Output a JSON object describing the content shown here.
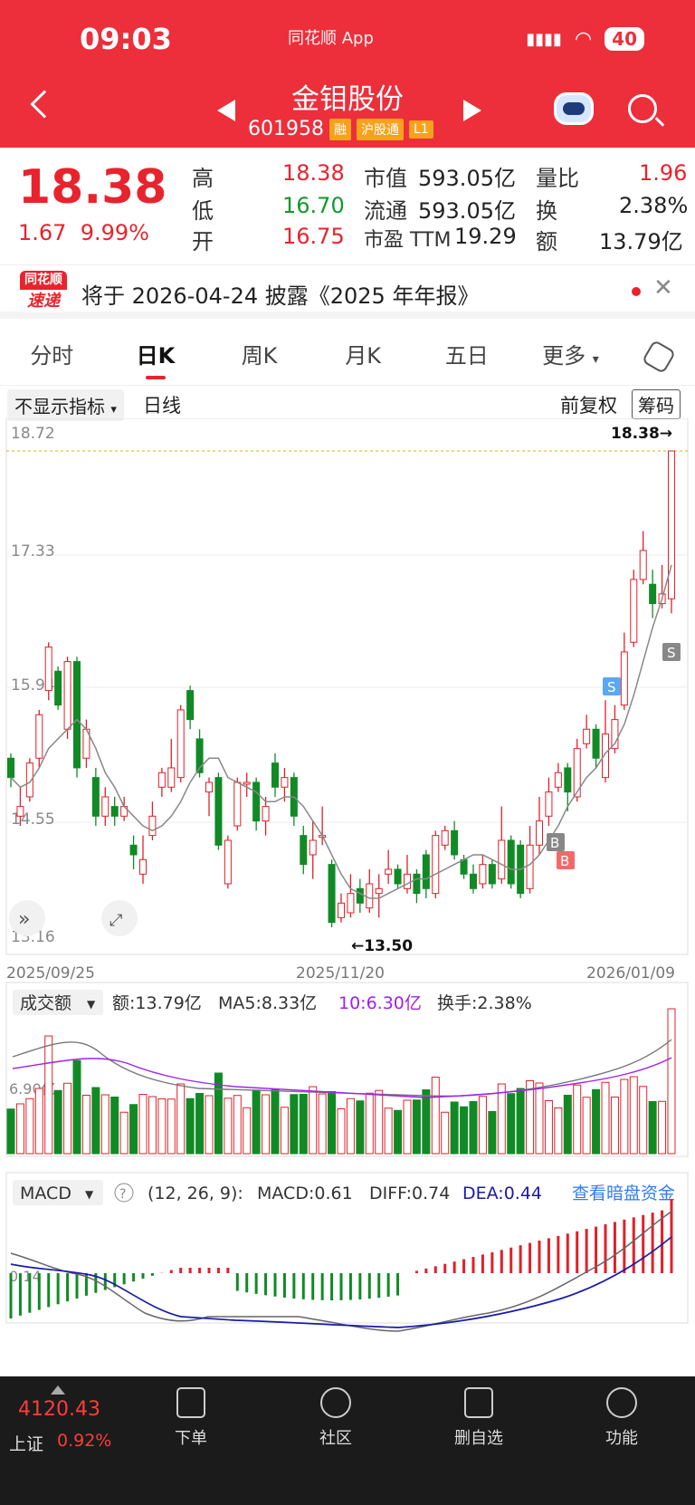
{
  "status_bar": {
    "time": "09:03",
    "app_label": "同花顺 App",
    "battery": "40"
  },
  "header": {
    "name": "金钼股份",
    "code": "601958",
    "tags": [
      "融",
      "沪股通",
      "L1"
    ]
  },
  "quote": {
    "price": "18.38",
    "change": "1.67",
    "change_pct": "9.99%",
    "rows": [
      {
        "l1": "高",
        "v1": "18.38",
        "c1": "red",
        "l2": "市值",
        "v2": "593.05亿",
        "l3": "量比",
        "v3": "1.96",
        "c3": "red"
      },
      {
        "l1": "低",
        "v1": "16.70",
        "c1": "green",
        "l2": "流通",
        "v2": "593.05亿",
        "l3": "换",
        "v3": "2.38%",
        "c3": "black"
      },
      {
        "l1": "开",
        "v1": "16.75",
        "c1": "red",
        "l2": "市盈 TTM",
        "v2": "19.29",
        "l3": "额",
        "v3": "13.79亿",
        "c3": "black"
      }
    ]
  },
  "notice": {
    "logo_top": "同花顺",
    "logo_bottom": "速递",
    "text": "将于 2026-04-24 披露《2025 年年报》"
  },
  "tabs": [
    "分时",
    "日K",
    "周K",
    "月K",
    "五日",
    "更多"
  ],
  "chart_toolbar": {
    "indicator": "不显示指标",
    "line": "日线",
    "adjust": "前复权",
    "chips": "筹码"
  },
  "price_axis": [
    "18.72",
    "17.33",
    "15.94",
    "14.55",
    "13.16"
  ],
  "date_axis": [
    "2025/09/25",
    "2025/11/20",
    "2026/01/09"
  ],
  "markers": {
    "high": "18.38→",
    "low": "←13.50",
    "sell": "S",
    "buy": "B"
  },
  "volume": {
    "label": "成交额",
    "amount": "额:13.79亿",
    "ma5": "MA5:8.33亿",
    "ma10": "10:6.30亿",
    "turnover": "换手:2.38%",
    "axis": "6.90亿"
  },
  "macd": {
    "label": "MACD",
    "params": "(12, 26, 9):",
    "macd": "MACD:0.61",
    "diff": "DIFF:0.74",
    "dea": "DEA:0.44",
    "link": "查看暗盘资金",
    "axis": "0.14"
  },
  "bottom_nav": {
    "index_value": "4120.43",
    "index_name": "上证",
    "index_pct": "0.92%",
    "items": [
      "下单",
      "社区",
      "删自选",
      "功能"
    ]
  },
  "chart_data": {
    "type": "candlestick",
    "candles": [
      [
        15.2,
        15.0,
        15.25,
        14.9
      ],
      [
        14.6,
        14.7,
        14.9,
        14.5
      ],
      [
        14.8,
        15.15,
        15.2,
        14.75
      ],
      [
        15.2,
        15.65,
        15.7,
        15.1
      ],
      [
        15.9,
        16.35,
        16.4,
        15.8
      ],
      [
        16.1,
        15.75,
        16.15,
        15.7
      ],
      [
        15.5,
        16.2,
        16.25,
        15.4
      ],
      [
        16.2,
        15.1,
        16.25,
        15.0
      ],
      [
        15.2,
        15.5,
        15.6,
        15.1
      ],
      [
        15.0,
        14.6,
        15.1,
        14.5
      ],
      [
        14.6,
        14.8,
        14.9,
        14.5
      ],
      [
        14.7,
        14.6,
        14.8,
        14.5
      ],
      [
        14.6,
        14.7,
        14.8,
        14.55
      ],
      [
        14.3,
        14.2,
        14.4,
        14.05
      ],
      [
        14.0,
        14.15,
        14.4,
        13.9
      ],
      [
        14.4,
        14.6,
        14.75,
        14.35
      ],
      [
        14.9,
        15.05,
        15.1,
        14.8
      ],
      [
        14.9,
        15.1,
        15.4,
        14.85
      ],
      [
        15.0,
        15.7,
        15.75,
        14.95
      ],
      [
        15.9,
        15.6,
        15.95,
        15.5
      ],
      [
        15.4,
        15.05,
        15.5,
        15.0
      ],
      [
        14.85,
        14.95,
        15.0,
        14.6
      ],
      [
        15.0,
        14.3,
        15.05,
        14.25
      ],
      [
        13.9,
        14.35,
        14.4,
        13.85
      ],
      [
        14.5,
        14.95,
        15.0,
        14.45
      ],
      [
        14.95,
        14.95,
        15.05,
        14.8
      ],
      [
        14.95,
        14.55,
        15.0,
        14.45
      ],
      [
        14.55,
        14.7,
        14.8,
        14.4
      ],
      [
        15.15,
        14.9,
        15.25,
        14.8
      ],
      [
        14.9,
        15.0,
        15.1,
        14.75
      ],
      [
        15.0,
        14.6,
        15.05,
        14.5
      ],
      [
        14.4,
        14.1,
        14.5,
        14.0
      ],
      [
        14.2,
        14.35,
        14.55,
        13.95
      ],
      [
        14.4,
        14.4,
        14.7,
        14.3
      ],
      [
        14.1,
        13.5,
        14.15,
        13.45
      ],
      [
        13.55,
        13.7,
        13.8,
        13.5
      ],
      [
        13.6,
        13.8,
        14.0,
        13.55
      ],
      [
        13.85,
        13.7,
        13.95,
        13.6
      ],
      [
        13.65,
        13.9,
        14.05,
        13.6
      ],
      [
        13.8,
        13.85,
        14.0,
        13.55
      ],
      [
        14.0,
        14.05,
        14.25,
        13.9
      ],
      [
        14.05,
        13.9,
        14.1,
        13.85
      ],
      [
        13.85,
        14.0,
        14.2,
        13.8
      ],
      [
        14.0,
        13.8,
        14.05,
        13.7
      ],
      [
        14.2,
        13.85,
        14.25,
        13.75
      ],
      [
        13.8,
        14.4,
        14.45,
        13.75
      ],
      [
        14.3,
        14.45,
        14.5,
        14.25
      ],
      [
        14.45,
        14.2,
        14.55,
        14.15
      ],
      [
        14.15,
        14.0,
        14.2,
        13.95
      ],
      [
        14.0,
        13.85,
        14.1,
        13.8
      ],
      [
        13.9,
        14.1,
        14.2,
        13.85
      ],
      [
        14.1,
        13.9,
        14.15,
        13.85
      ],
      [
        13.95,
        14.35,
        14.7,
        13.9
      ],
      [
        14.35,
        13.9,
        14.4,
        13.85
      ],
      [
        14.3,
        13.8,
        14.35,
        13.75
      ],
      [
        13.85,
        14.3,
        14.5,
        13.8
      ],
      [
        14.3,
        14.55,
        14.8,
        14.2
      ],
      [
        14.6,
        14.85,
        15.0,
        14.5
      ],
      [
        14.9,
        15.05,
        15.15,
        14.85
      ],
      [
        15.1,
        14.85,
        15.15,
        14.65
      ],
      [
        14.8,
        15.3,
        15.4,
        14.75
      ],
      [
        15.35,
        15.5,
        15.65,
        15.3
      ],
      [
        15.5,
        15.2,
        15.55,
        15.1
      ],
      [
        15.0,
        15.45,
        15.8,
        14.95
      ],
      [
        15.3,
        15.6,
        15.75,
        15.25
      ],
      [
        15.75,
        16.3,
        16.5,
        15.7
      ],
      [
        16.4,
        17.05,
        17.15,
        16.35
      ],
      [
        17.05,
        17.35,
        17.55,
        17.0
      ],
      [
        17.0,
        16.8,
        17.15,
        16.65
      ],
      [
        16.8,
        16.9,
        17.2,
        16.75
      ],
      [
        16.85,
        18.38,
        18.38,
        16.7
      ]
    ],
    "ma5": [
      15.0,
      14.9,
      14.95,
      15.1,
      15.3,
      15.4,
      15.5,
      15.6,
      15.5,
      15.3,
      15.05,
      14.9,
      14.7,
      14.6,
      14.5,
      14.45,
      14.5,
      14.6,
      14.75,
      14.95,
      15.1,
      15.2,
      15.2,
      15.0,
      14.95,
      14.9,
      14.85,
      14.75,
      14.75,
      14.8,
      14.8,
      14.7,
      14.55,
      14.4,
      14.2,
      14.0,
      13.85,
      13.8,
      13.75,
      13.75,
      13.8,
      13.85,
      13.9,
      13.95,
      13.95,
      14.0,
      14.05,
      14.1,
      14.15,
      14.2,
      14.2,
      14.15,
      14.1,
      14.05,
      14.05,
      14.1,
      14.2,
      14.35,
      14.5,
      14.7,
      14.85,
      15.0,
      15.1,
      15.25,
      15.35,
      15.55,
      15.85,
      16.2,
      16.55,
      16.85,
      17.2
    ],
    "title": "金钼股份 日K"
  }
}
